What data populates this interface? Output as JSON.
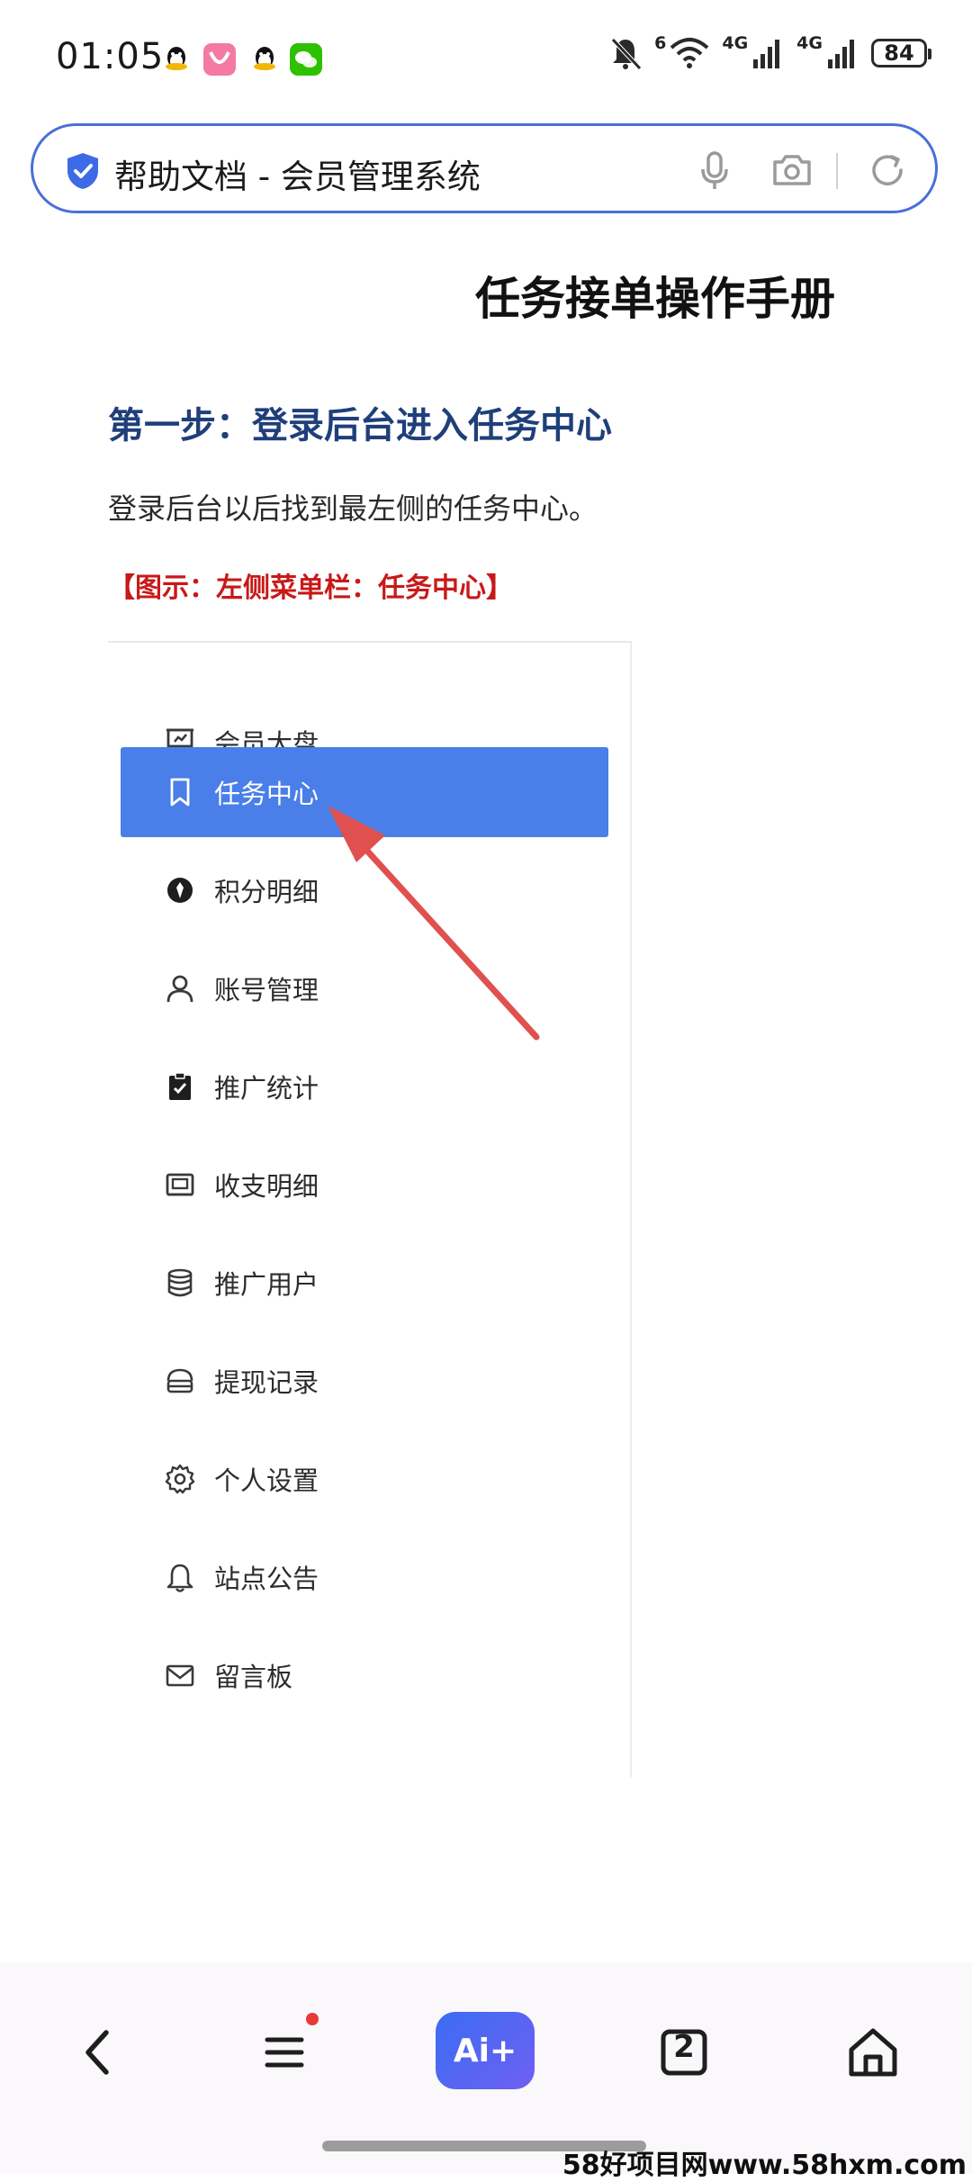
{
  "status_bar": {
    "time": "01:05",
    "network_1": "4G",
    "network_2": "4G",
    "wifi_badge": "6",
    "battery": "84",
    "notification_icons": [
      "qq-icon",
      "app-icon",
      "qq-icon",
      "wechat-icon"
    ]
  },
  "browser": {
    "page_title": "帮助文档 - 会员管理系统",
    "icons": [
      "shield-icon",
      "microphone-icon",
      "camera-icon",
      "refresh-icon"
    ]
  },
  "document": {
    "title": "任务接单操作手册",
    "step_heading": "第一步：登录后台进入任务中心",
    "paragraph": "登录后台以后找到最左侧的任务中心。",
    "figure_caption": "【图示：左侧菜单栏：任务中心】"
  },
  "menu": {
    "items": [
      {
        "label": "会员大盘",
        "icon": "dashboard-icon",
        "active": false
      },
      {
        "label": "任务中心",
        "icon": "bookmark-icon",
        "active": true
      },
      {
        "label": "积分明细",
        "icon": "points-icon",
        "active": false
      },
      {
        "label": "账号管理",
        "icon": "user-icon",
        "active": false
      },
      {
        "label": "推广统计",
        "icon": "clipboard-icon",
        "active": false
      },
      {
        "label": "收支明细",
        "icon": "wallet-icon",
        "active": false
      },
      {
        "label": "推广用户",
        "icon": "database-icon",
        "active": false
      },
      {
        "label": "提现记录",
        "icon": "withdraw-icon",
        "active": false
      },
      {
        "label": "个人设置",
        "icon": "gear-icon",
        "active": false
      },
      {
        "label": "站点公告",
        "icon": "bell-icon",
        "active": false
      },
      {
        "label": "留言板",
        "icon": "mail-icon",
        "active": false
      }
    ]
  },
  "bottom_nav": {
    "ai_label": "Ai+",
    "tabs_count": "2",
    "icons": [
      "back-icon",
      "menu-icon",
      "ai-icon",
      "tabs-icon",
      "home-icon"
    ],
    "active_accent": "#4a7ee8"
  },
  "watermark": "58好项目网www.58hxm.com"
}
